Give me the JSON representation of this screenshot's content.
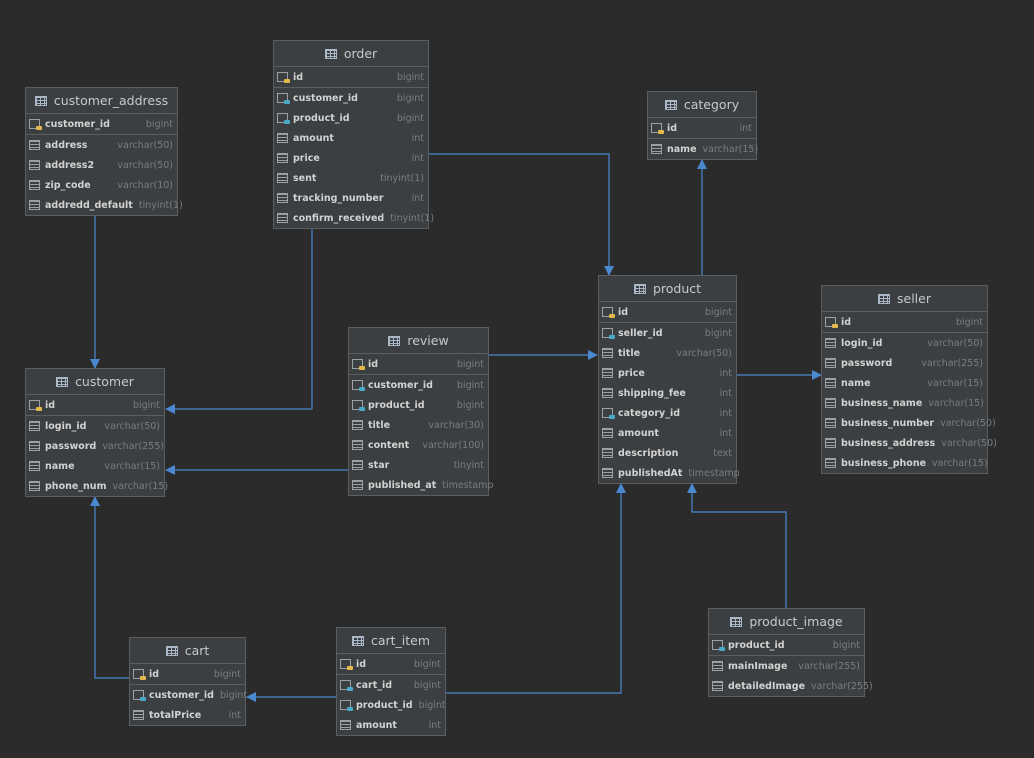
{
  "tables": {
    "customer_address": {
      "title": "customer_address",
      "pk": [
        {
          "name": "customer_id",
          "type": "bigint",
          "icon": "primary-key-icon"
        }
      ],
      "cols": [
        {
          "name": "address",
          "type": "varchar(50)",
          "icon": "column-icon"
        },
        {
          "name": "address2",
          "type": "varchar(50)",
          "icon": "column-icon"
        },
        {
          "name": "zip_code",
          "type": "varchar(10)",
          "icon": "column-icon"
        },
        {
          "name": "addredd_default",
          "type": "tinyint(1)",
          "icon": "column-icon"
        }
      ]
    },
    "order": {
      "title": "order",
      "pk": [
        {
          "name": "id",
          "type": "bigint",
          "icon": "primary-key-icon"
        }
      ],
      "cols": [
        {
          "name": "customer_id",
          "type": "bigint",
          "icon": "foreign-key-icon"
        },
        {
          "name": "product_id",
          "type": "bigint",
          "icon": "foreign-key-icon"
        },
        {
          "name": "amount",
          "type": "int",
          "icon": "column-icon"
        },
        {
          "name": "price",
          "type": "int",
          "icon": "column-icon"
        },
        {
          "name": "sent",
          "type": "tinyint(1)",
          "icon": "column-icon"
        },
        {
          "name": "tracking_number",
          "type": "int",
          "icon": "column-icon"
        },
        {
          "name": "confirm_received",
          "type": "tinyint(1)",
          "icon": "column-icon"
        }
      ]
    },
    "category": {
      "title": "category",
      "pk": [
        {
          "name": "id",
          "type": "int",
          "icon": "primary-key-icon"
        }
      ],
      "cols": [
        {
          "name": "name",
          "type": "varchar(15)",
          "icon": "column-icon"
        }
      ]
    },
    "product": {
      "title": "product",
      "pk": [
        {
          "name": "id",
          "type": "bigint",
          "icon": "primary-key-icon"
        }
      ],
      "cols": [
        {
          "name": "seller_id",
          "type": "bigint",
          "icon": "foreign-key-icon"
        },
        {
          "name": "title",
          "type": "varchar(50)",
          "icon": "column-icon"
        },
        {
          "name": "price",
          "type": "int",
          "icon": "column-icon"
        },
        {
          "name": "shipping_fee",
          "type": "int",
          "icon": "column-icon"
        },
        {
          "name": "category_id",
          "type": "int",
          "icon": "foreign-key-icon"
        },
        {
          "name": "amount",
          "type": "int",
          "icon": "column-icon"
        },
        {
          "name": "description",
          "type": "text",
          "icon": "column-icon"
        },
        {
          "name": "publishedAt",
          "type": "timestamp",
          "icon": "column-icon"
        }
      ]
    },
    "seller": {
      "title": "seller",
      "pk": [
        {
          "name": "id",
          "type": "bigint",
          "icon": "primary-key-icon"
        }
      ],
      "cols": [
        {
          "name": "login_id",
          "type": "varchar(50)",
          "icon": "column-icon"
        },
        {
          "name": "password",
          "type": "varchar(255)",
          "icon": "column-icon"
        },
        {
          "name": "name",
          "type": "varchar(15)",
          "icon": "column-icon"
        },
        {
          "name": "business_name",
          "type": "varchar(15)",
          "icon": "column-icon"
        },
        {
          "name": "business_number",
          "type": "varchar(50)",
          "icon": "column-icon"
        },
        {
          "name": "business_address",
          "type": "varchar(50)",
          "icon": "column-icon"
        },
        {
          "name": "business_phone",
          "type": "varchar(15)",
          "icon": "column-icon"
        }
      ]
    },
    "customer": {
      "title": "customer",
      "pk": [
        {
          "name": "id",
          "type": "bigint",
          "icon": "primary-key-icon"
        }
      ],
      "cols": [
        {
          "name": "login_id",
          "type": "varchar(50)",
          "icon": "column-icon"
        },
        {
          "name": "password",
          "type": "varchar(255)",
          "icon": "column-icon"
        },
        {
          "name": "name",
          "type": "varchar(15)",
          "icon": "column-icon"
        },
        {
          "name": "phone_num",
          "type": "varchar(15)",
          "icon": "column-icon"
        }
      ]
    },
    "review": {
      "title": "review",
      "pk": [
        {
          "name": "id",
          "type": "bigint",
          "icon": "primary-key-icon"
        }
      ],
      "cols": [
        {
          "name": "customer_id",
          "type": "bigint",
          "icon": "foreign-key-icon"
        },
        {
          "name": "product_id",
          "type": "bigint",
          "icon": "foreign-key-icon"
        },
        {
          "name": "title",
          "type": "varchar(30)",
          "icon": "column-icon"
        },
        {
          "name": "content",
          "type": "varchar(100)",
          "icon": "column-icon"
        },
        {
          "name": "star",
          "type": "tinyint",
          "icon": "column-icon"
        },
        {
          "name": "published_at",
          "type": "timestamp",
          "icon": "column-icon"
        }
      ]
    },
    "product_image": {
      "title": "product_image",
      "pk": [
        {
          "name": "product_id",
          "type": "bigint",
          "icon": "foreign-key-icon"
        }
      ],
      "cols": [
        {
          "name": "mainImage",
          "type": "varchar(255)",
          "icon": "column-icon"
        },
        {
          "name": "detailedImage",
          "type": "varchar(255)",
          "icon": "column-icon"
        }
      ]
    },
    "cart": {
      "title": "cart",
      "pk": [
        {
          "name": "id",
          "type": "bigint",
          "icon": "primary-key-icon"
        }
      ],
      "cols": [
        {
          "name": "customer_id",
          "type": "bigint",
          "icon": "foreign-key-icon"
        },
        {
          "name": "totalPrice",
          "type": "int",
          "icon": "column-icon"
        }
      ]
    },
    "cart_item": {
      "title": "cart_item",
      "pk": [
        {
          "name": "id",
          "type": "bigint",
          "icon": "primary-key-icon"
        }
      ],
      "cols": [
        {
          "name": "cart_id",
          "type": "bigint",
          "icon": "foreign-key-icon"
        },
        {
          "name": "product_id",
          "type": "bigint",
          "icon": "foreign-key-icon"
        },
        {
          "name": "amount",
          "type": "int",
          "icon": "column-icon"
        }
      ]
    }
  },
  "colors": {
    "background": "#2b2b2b",
    "table_fill": "#3c3f41",
    "edge": "#4a88d0"
  }
}
